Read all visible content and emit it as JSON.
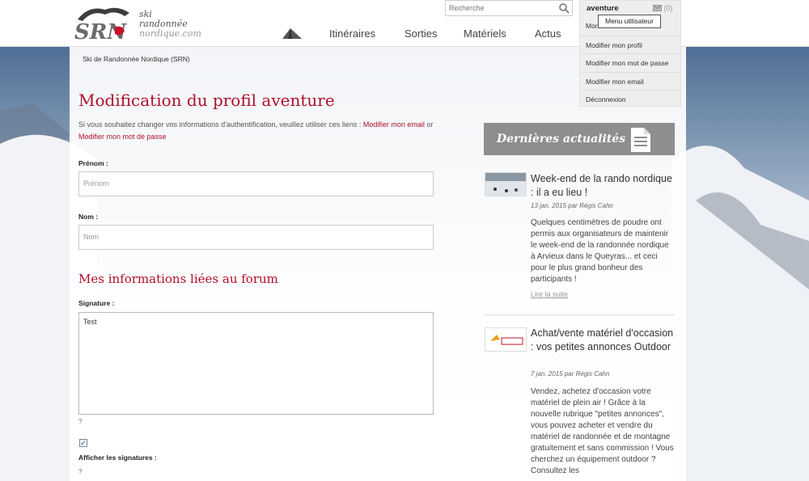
{
  "header": {
    "logo_text": "SRN",
    "tagline": [
      "ski",
      "randonnée",
      "nordique.com"
    ],
    "search_placeholder": "Recherche",
    "nav": [
      {
        "label": "Itinéraires"
      },
      {
        "label": "Sorties"
      },
      {
        "label": "Matériels"
      },
      {
        "label": "Actus"
      }
    ]
  },
  "user_menu": {
    "username": "aventure",
    "mail_count": "(0)",
    "tooltip": "Menu utilisateur",
    "items": [
      {
        "label": "Mon..."
      },
      {
        "label": "Modifier mon profil"
      },
      {
        "label": "Modifier mon mot de passe"
      },
      {
        "label": "Modifier mon email"
      },
      {
        "label": "Déconnexion"
      }
    ]
  },
  "breadcrumb": "Ski de Randonnée Nordique (SRN)",
  "page": {
    "title": "Modification du profil aventure",
    "intro_prefix": "Si vous souhaitez changer vos informations d'authentification, veuillez utiliser ces liens : ",
    "link_email": "Modifier mon email",
    "intro_or": " or ",
    "link_password": "Modifier mon mot de passe",
    "fields": {
      "firstname_label": "Prénom :",
      "firstname_placeholder": "Prénom",
      "lastname_label": "Nom :",
      "lastname_placeholder": "Nom"
    },
    "forum_title": "Mes informations liées au forum",
    "signature_label": "Signature :",
    "signature_value": "Test",
    "help_mark": "?",
    "show_signatures_checked": true,
    "show_signatures_label": "Afficher les signatures :",
    "help_mark2": "?"
  },
  "sidebar": {
    "title": "Dernières actualités",
    "news": [
      {
        "title": "Week-end de la rando nordique : il a eu lieu !",
        "date": "13 jan. 2015",
        "by": "par",
        "author": "Régis Cahn",
        "body": "Quelques centimètres de poudre ont permis aux organisateurs de maintenir le week-end de la randonnée nordique à Arvieux dans le Queyras... et ceci pour le plus grand bonheur des participants !",
        "more": "Lire la suite"
      },
      {
        "title": "Achat/vente matériel d'occasion : vos petites annonces Outdoor",
        "date": "7 jan. 2015",
        "by": "par",
        "author": "Régis Cahn",
        "body": "Vendez, achetez d'occasion votre matériel de plein air ! Grâce à la nouvelle rubrique \"petites annonces\", vous pouvez acheter et vendre du matériel de randonnée et de montagne gratuitement et sans commission ! Vous cherchez un équipement outdoor ? Consultez les"
      }
    ]
  }
}
